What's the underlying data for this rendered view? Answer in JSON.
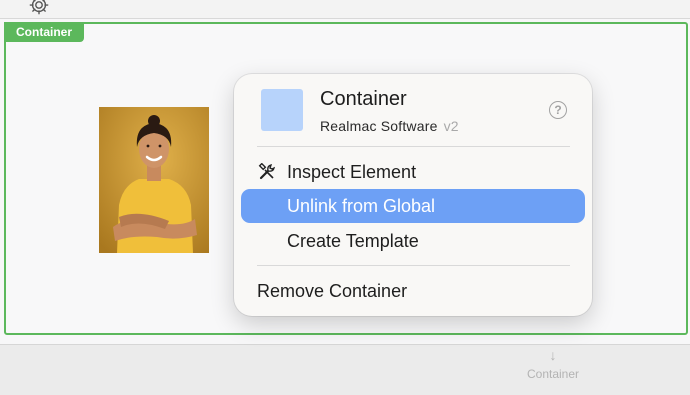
{
  "toolbar": {
    "settings_icon": "gear-icon"
  },
  "container": {
    "tag_label": "Container",
    "border_color": "#5cb85c",
    "image": {
      "description": "woman-photo"
    }
  },
  "popover": {
    "title": "Container",
    "vendor": "Realmac Software",
    "version": "v2",
    "help_label": "?",
    "swatch_color": "#b7d3fb",
    "menu": {
      "inspect": "Inspect Element",
      "unlink": "Unlink from Global",
      "template": "Create Template",
      "remove": "Remove Container"
    },
    "selected_color": "#6da0f5"
  },
  "add_hint": {
    "arrow": "↓",
    "label": "Container"
  }
}
